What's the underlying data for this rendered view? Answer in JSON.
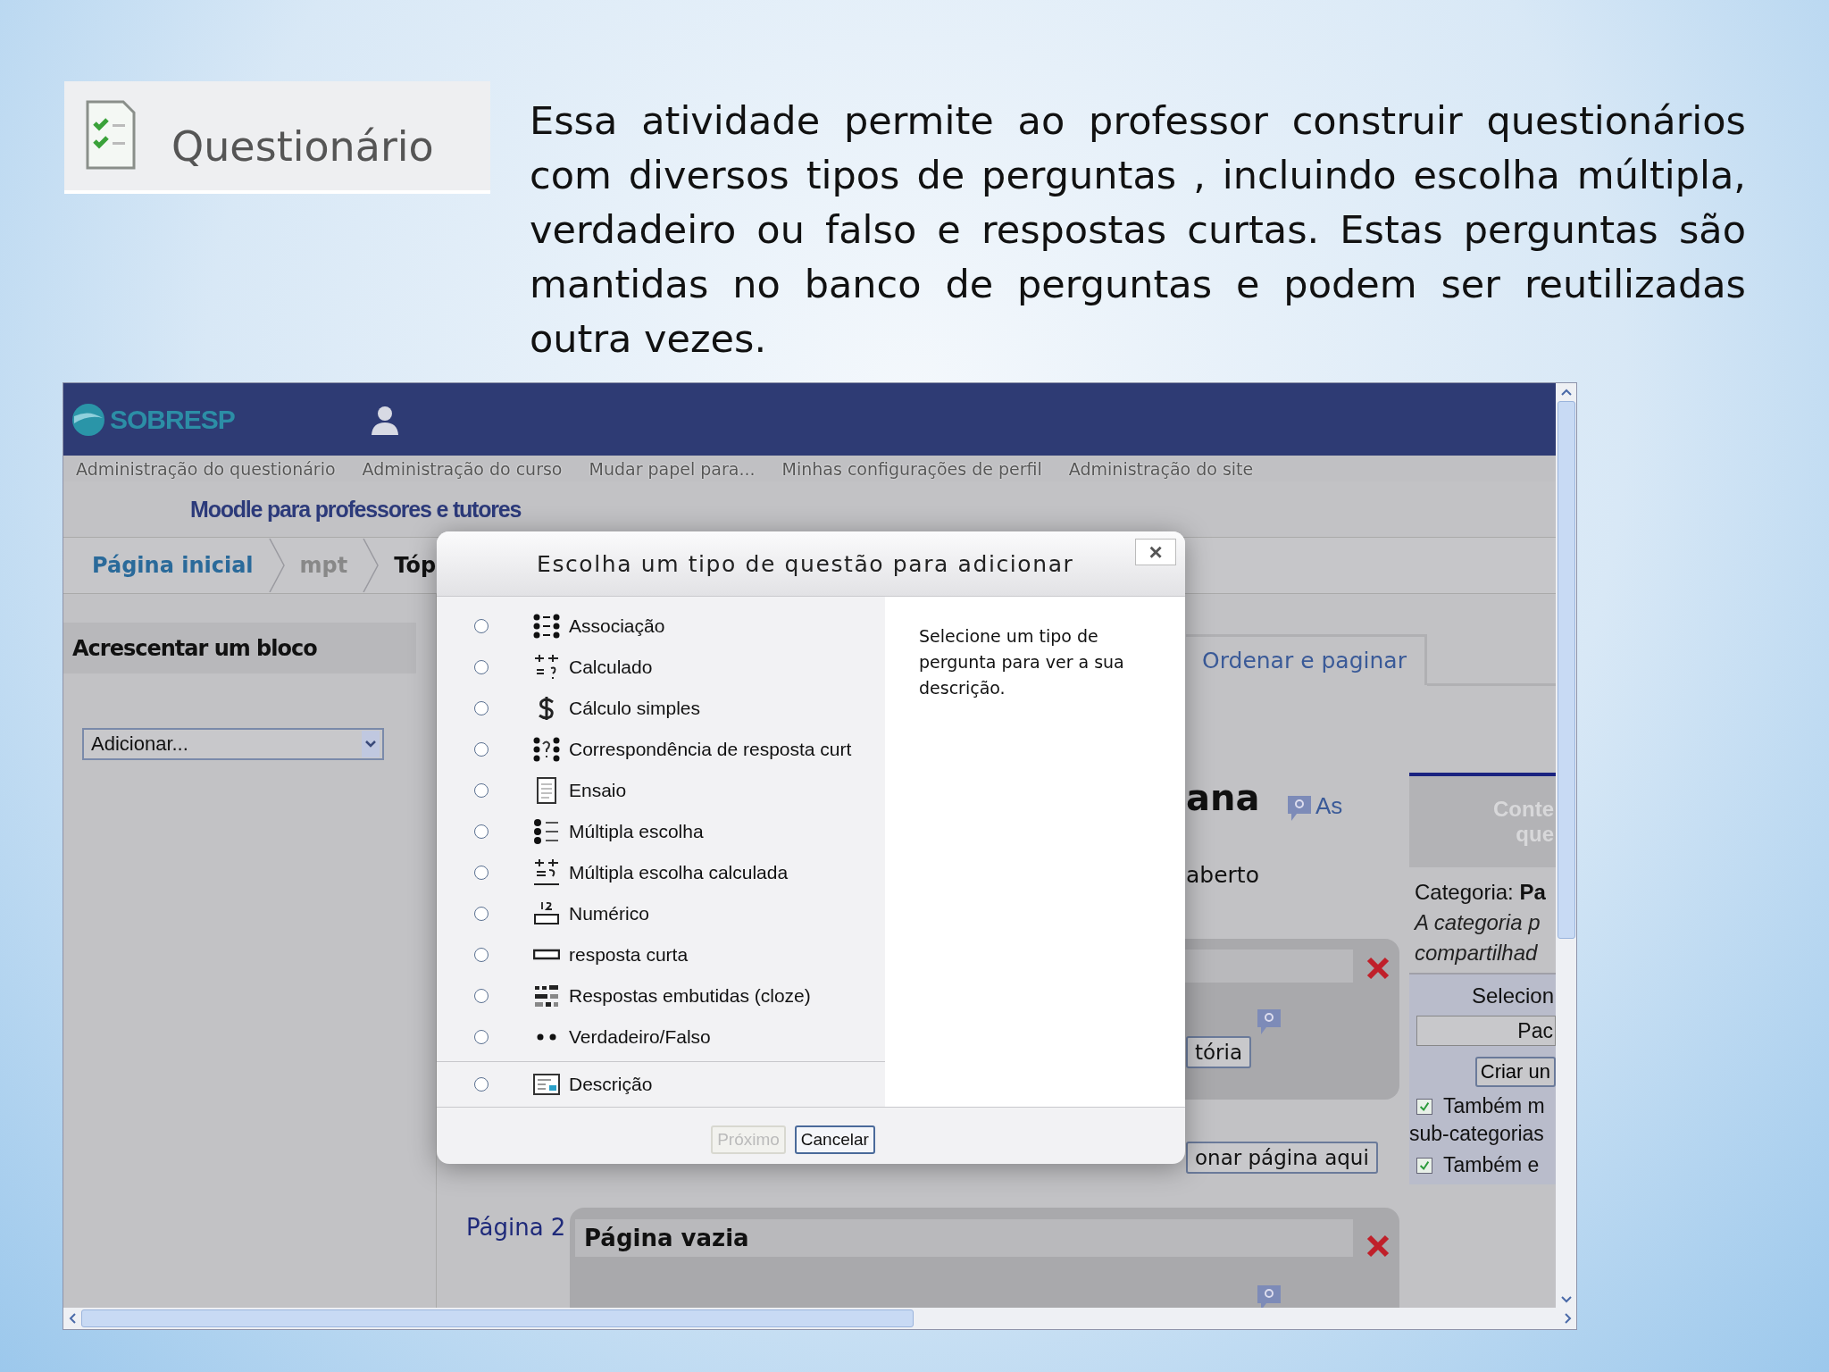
{
  "slide": {
    "heading": "Questionário",
    "text": "Essa atividade permite ao professor construir questionários com diversos tipos de perguntas , incluindo escolha múltipla, verdadeiro ou falso e respostas curtas. Estas perguntas são mantidas no banco de perguntas e podem ser reutilizadas outra vezes."
  },
  "screenshot": {
    "site_name": "SOBRESP",
    "menu": [
      "Administração do questionário",
      "Administração do curso",
      "Mudar papel para...",
      "Minhas configurações de perfil",
      "Administração do site"
    ],
    "course_title": "Moodle para professores e tutores",
    "breadcrumb": [
      "Página inicial",
      "mpt",
      "Tóp"
    ],
    "block": {
      "title": "Acrescentar um bloco",
      "select": "Adicionar..."
    },
    "dialog": {
      "title": "Escolha um tipo de questão para adicionar",
      "close": "×",
      "options": [
        {
          "label": "Associação",
          "kind": "matching",
          "selected": false
        },
        {
          "label": "Calculado",
          "kind": "calculated",
          "selected": false
        },
        {
          "label": "Cálculo simples",
          "kind": "simplecalc",
          "selected": false
        },
        {
          "label": "Correspondência de resposta curt",
          "kind": "shortmatch",
          "selected": false
        },
        {
          "label": "Ensaio",
          "kind": "essay",
          "selected": false
        },
        {
          "label": "Múltipla escolha",
          "kind": "multichoice",
          "selected": false
        },
        {
          "label": "Múltipla escolha calculada",
          "kind": "calcmulti",
          "selected": false
        },
        {
          "label": "Numérico",
          "kind": "numerical",
          "selected": false
        },
        {
          "label": "resposta curta",
          "kind": "shortanswer",
          "selected": false
        },
        {
          "label": "Respostas embutidas (cloze)",
          "kind": "cloze",
          "selected": false
        },
        {
          "label": "Verdadeiro/Falso",
          "kind": "truefalse",
          "selected": false
        },
        {
          "label": "Descrição",
          "kind": "description",
          "selected": false
        }
      ],
      "description": "Selecione um tipo de pergunta para ver a sua descrição.",
      "buttons": [
        {
          "label": "Próximo",
          "disabled": true
        },
        {
          "label": "Cancelar",
          "disabled": false
        }
      ]
    },
    "background": {
      "tab": "Ordenar e paginar",
      "heading": "ana",
      "help_label": "As",
      "status": "aberto",
      "page1_button": "tória",
      "add_page_button": "onar página aqui",
      "page2_label": "Página 2",
      "page2_title": "Página vazia"
    },
    "question_bank": {
      "header": [
        "Conte",
        "que"
      ],
      "category": "Categoria: **Pa**",
      "note": [
        "A categoria p",
        "compartilhad"
      ],
      "select_label": "Selecion",
      "select_value": "Pac",
      "create_button": "Criar un",
      "options": [
        {
          "label": "Também m",
          "continuation": "sub-categorias",
          "checked": true
        },
        {
          "label": "Também e",
          "checked": true
        }
      ]
    }
  }
}
